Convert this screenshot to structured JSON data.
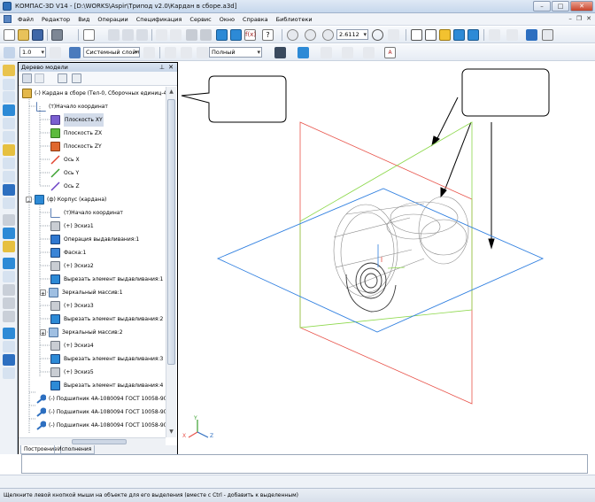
{
  "window": {
    "title": "КОМПАС-3D V14 - [D:\\WORKS\\Aspir\\Трипод v2.0\\Кардан в сборе.a3d]"
  },
  "menu": {
    "items": [
      "Файл",
      "Редактор",
      "Вид",
      "Операции",
      "Спецификация",
      "Сервис",
      "Окно",
      "Справка",
      "Библиотеки"
    ]
  },
  "toolbar": {
    "zoom_value": "2.6112",
    "scale_value": "1.0",
    "layer_value": "Системный слой (0)",
    "style_value": "Полный"
  },
  "tree_panel": {
    "title": "Дерево модели",
    "nodes": [
      "(-) Кардан в сборе (Тел-0, Сборочных единиц-4,",
      "(т)Начало координат",
      "Плоскость XY",
      "Плоскость ZX",
      "Плоскость ZY",
      "Ось X",
      "Ось Y",
      "Ось Z",
      "(ф) Корпус (кардана)",
      "(т)Начало координат",
      "(+) Эскиз1",
      "Операция выдавливания:1",
      "Фаска:1",
      "(+) Эскиз2",
      "Вырезать элемент выдавливания:1",
      "Зеркальный массив:1",
      "(+) Эскиз3",
      "Вырезать элемент выдавливания:2",
      "Зеркальный массив:2",
      "(+) Эскиз4",
      "Вырезать элемент выдавливания:3",
      "(+) Эскиз5",
      "Вырезать элемент выдавливания:4",
      "(-) Подшипник 4А-1080094 ГОСТ 10058-90",
      "(-) Подшипник 4А-1080094 ГОСТ 10058-90",
      "(-) Подшипник 4А-1080094 ГОСТ 10058-90"
    ],
    "tabs": [
      "Построение",
      "Исполнения"
    ]
  },
  "axis_labels": {
    "x": "X",
    "y": "Y",
    "z": "Z"
  },
  "status": {
    "hint": "Щелкните левой кнопкой мыши на объекте для его выделения (вместе с Ctrl - добавить к выделенным)"
  },
  "colors": {
    "plane_xy": "#2f7fe0",
    "plane_zx": "#8cd84a",
    "plane_zy": "#e8534a",
    "accent": "#2f6fb9"
  }
}
